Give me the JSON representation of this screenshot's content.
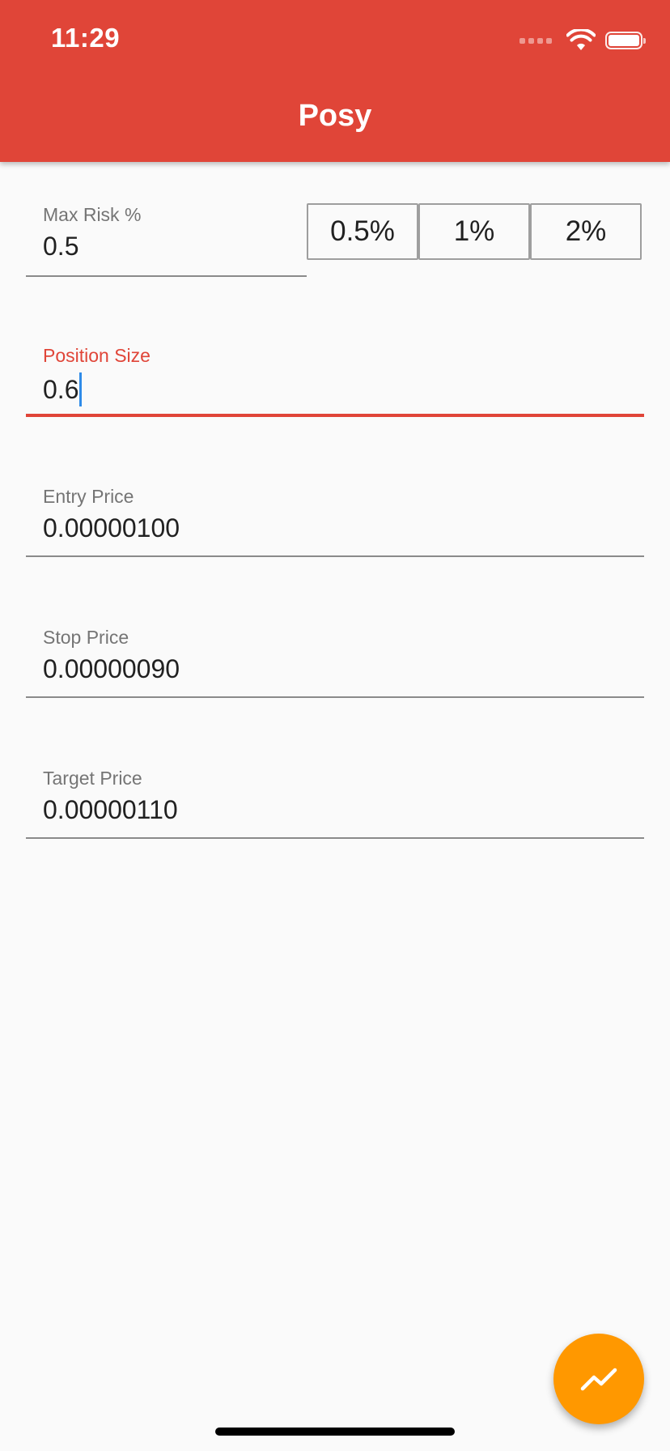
{
  "status_bar": {
    "time": "11:29"
  },
  "app_bar": {
    "title": "Posy",
    "color": "#e04538"
  },
  "form": {
    "max_risk": {
      "label": "Max Risk %",
      "value": "0.5",
      "presets": [
        "0.5%",
        "1%",
        "2%"
      ]
    },
    "position_size": {
      "label": "Position Size",
      "value": "0.6",
      "focused": true
    },
    "entry_price": {
      "label": "Entry Price",
      "value": "0.00000100"
    },
    "stop_price": {
      "label": "Stop Price",
      "value": "0.00000090"
    },
    "target_price": {
      "label": "Target Price",
      "value": "0.00000110"
    }
  },
  "fab": {
    "icon": "trending-up-icon",
    "color": "#ff9800"
  },
  "colors": {
    "accent": "#e04538",
    "caret": "#2f8be8",
    "background": "#fafafa"
  }
}
